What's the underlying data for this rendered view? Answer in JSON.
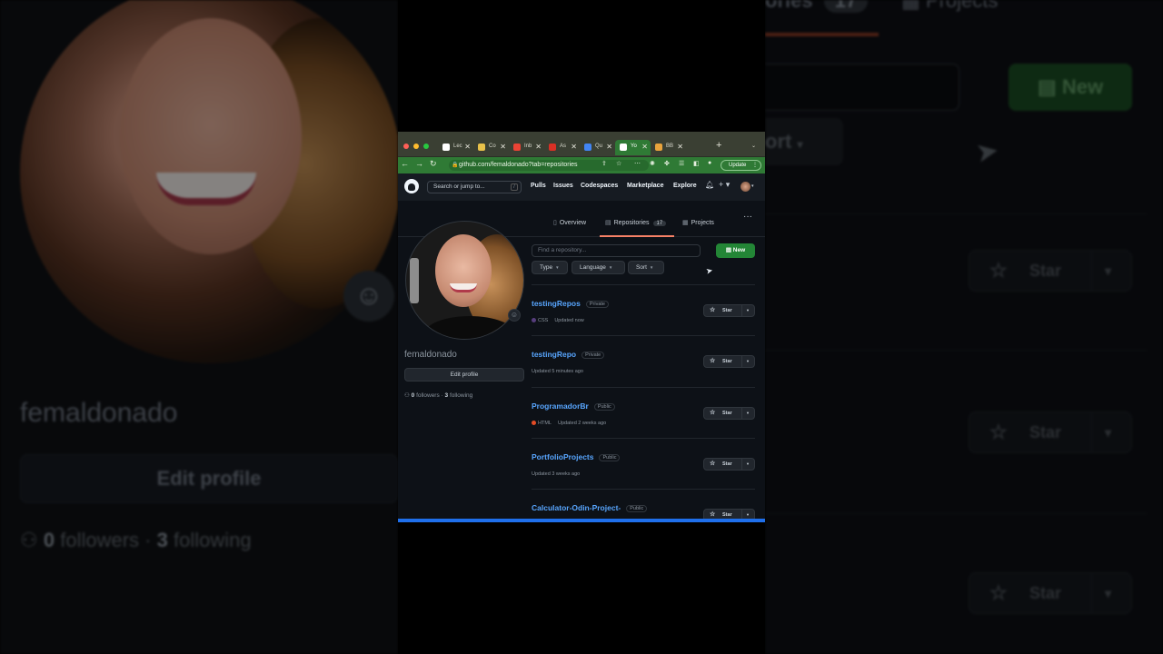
{
  "browser": {
    "tabs": [
      {
        "label": "Lec",
        "icon_color": "#ffffff",
        "active": false
      },
      {
        "label": "Co",
        "icon_color": "#e8c14a",
        "active": false
      },
      {
        "label": "Inb",
        "icon_color": "#ea4335",
        "active": false
      },
      {
        "label": "As",
        "icon_color": "#d93025",
        "active": false
      },
      {
        "label": "Qu",
        "icon_color": "#4285f4",
        "active": false
      },
      {
        "label": "Yo",
        "icon_color": "#ffffff",
        "active": true
      },
      {
        "label": "BB",
        "icon_color": "#e8a33c",
        "active": false
      }
    ],
    "close_glyph": "✕",
    "new_tab_glyph": "+",
    "tab_menu_glyph": "⌄",
    "url": "github.com/femaldonado?tab=repositories",
    "update_label": "Update"
  },
  "github": {
    "search_placeholder": "Search or jump to...",
    "search_shortcut": "/",
    "nav": [
      "Pulls",
      "Issues",
      "Codespaces",
      "Marketplace",
      "Explore"
    ],
    "tabs": {
      "overview": "Overview",
      "repositories": "Repositories",
      "repositories_count": "17",
      "projects": "Projects"
    },
    "more_glyph": "···"
  },
  "profile": {
    "username": "femaldonado",
    "edit_label": "Edit profile",
    "followers_count": "0",
    "followers_label": "followers",
    "separator": "·",
    "following_count": "3",
    "following_label": "following"
  },
  "repo_toolbar": {
    "search_placeholder": "Find a repository...",
    "new_label": "New",
    "filters": [
      "Type",
      "Language",
      "Sort"
    ]
  },
  "repos": [
    {
      "name": "testingRepos",
      "visibility": "Private",
      "language": "CSS",
      "language_color": "#563d7c",
      "updated": "Updated now"
    },
    {
      "name": "testingRepo",
      "visibility": "Private",
      "language": "",
      "language_color": "",
      "updated": "Updated 5 minutes ago"
    },
    {
      "name": "ProgramadorBr",
      "visibility": "Public",
      "language": "HTML",
      "language_color": "#e34c26",
      "updated": "Updated 2 weeks ago"
    },
    {
      "name": "PortfolioProjects",
      "visibility": "Public",
      "language": "",
      "language_color": "",
      "updated": "Updated 3 weeks ago"
    },
    {
      "name": "Calculator-Odin-Project-",
      "visibility": "Public",
      "language": "",
      "language_color": "",
      "updated": ""
    }
  ],
  "star_label": "Star",
  "background_zoom": {
    "repositories_label": "ories",
    "repositories_count": "17",
    "projects_label": "Projects",
    "new_label": "New",
    "sort_label": "ort",
    "star_label": "Star",
    "username": "femaldonado",
    "edit_label": "Edit profile",
    "followers_count": "0",
    "followers_label": "followers",
    "separator": "·",
    "following_count": "3",
    "following_label": "following"
  },
  "colors": {
    "accent_green": "#238636",
    "link_blue": "#58a6ff",
    "tab_underline": "#f78166",
    "browser_frame": "#2f7a35"
  }
}
